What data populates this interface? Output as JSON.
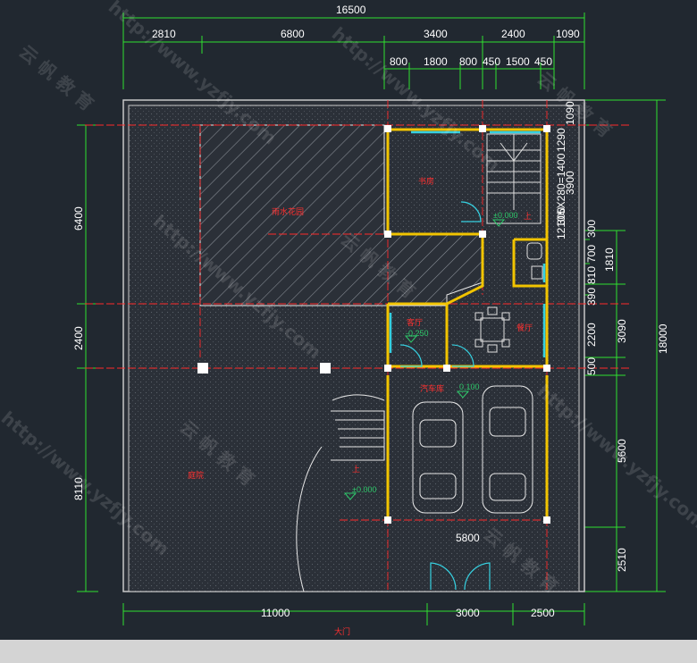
{
  "dimensions": {
    "top_total": "16500",
    "top_row1": [
      "2810",
      "6800",
      "3400",
      "2400",
      "1090"
    ],
    "top_row2": [
      "800",
      "1800",
      "800",
      "450",
      "1500",
      "450"
    ],
    "right_inner": [
      "1090",
      "3900",
      "1210",
      "5X280=1400",
      "1290",
      "300",
      "810",
      "700",
      "300",
      "390"
    ],
    "right_outer": [
      "1810",
      "2200",
      "3090",
      "500",
      "5600",
      "2510"
    ],
    "right_total": "18000",
    "left": [
      "6400",
      "2400",
      "8110"
    ],
    "garage_width": "5800",
    "bottom": [
      "11000",
      "3000",
      "2500"
    ]
  },
  "rooms": {
    "study": "书房",
    "rain_garden": "雨水花园",
    "living": "客厅",
    "dining": "餐厅",
    "garage": "汽车库",
    "yard": "庭院",
    "gate": "大门"
  },
  "levels": {
    "garage": "0.100",
    "living": "-0.250",
    "stair": "±0.000",
    "yard": "±0.000",
    "up_stair": "上",
    "up_yard": "上"
  },
  "watermark": {
    "url": "http://www.yzfjy.com",
    "brand": "云 帆 教 育"
  }
}
